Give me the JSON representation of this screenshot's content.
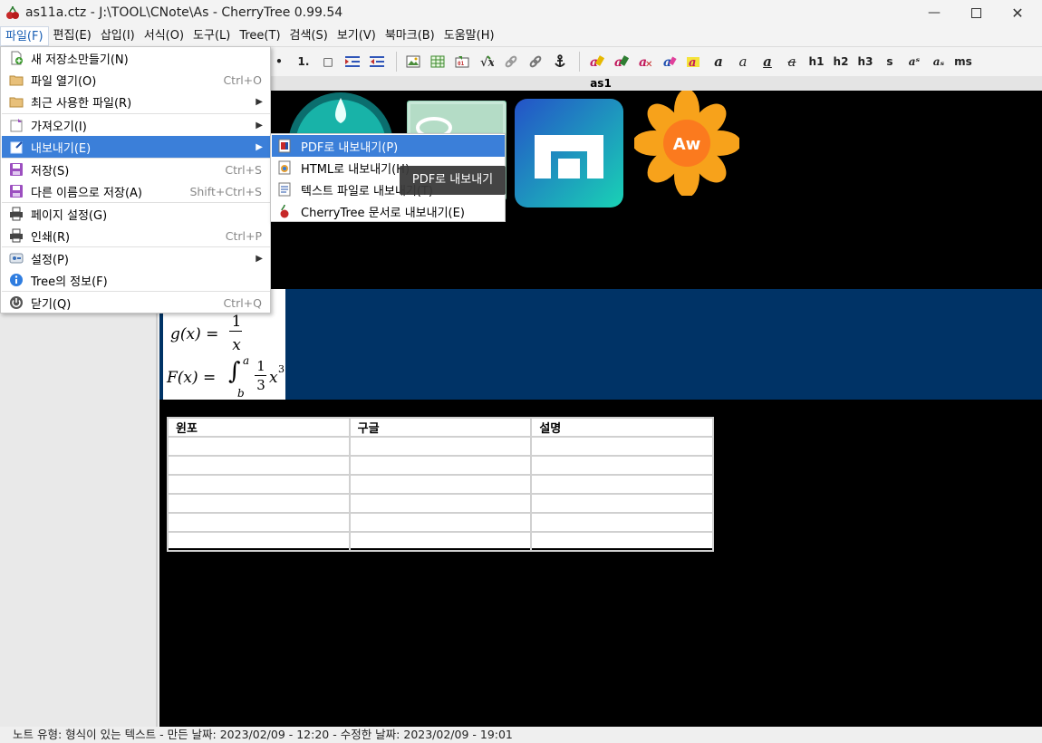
{
  "window": {
    "title": "as11a.ctz - J:\\TOOL\\CNote\\As - CherryTree 0.99.54",
    "minimize_icon": "minimize-icon",
    "maximize_icon": "maximize-icon",
    "close_icon": "close-icon"
  },
  "menubar": [
    {
      "label": "파일(F)",
      "active": true
    },
    {
      "label": "편집(E)"
    },
    {
      "label": "삽입(I)"
    },
    {
      "label": "서식(O)"
    },
    {
      "label": "도구(L)"
    },
    {
      "label": "Tree(T)"
    },
    {
      "label": "검색(S)"
    },
    {
      "label": "보기(V)"
    },
    {
      "label": "북마크(B)"
    },
    {
      "label": "도움말(H)"
    }
  ],
  "toolbar": {
    "list_items": [
      "•",
      "1.",
      "□"
    ],
    "format_items": [
      "h1",
      "h2",
      "h3",
      "s",
      "aˢ",
      "aₛ",
      "ms"
    ]
  },
  "node_title": "as1",
  "file_menu": {
    "items": [
      {
        "label": "새 저장소만들기(N)",
        "accel": "",
        "icon": "new-file-icon"
      },
      {
        "label": "파일 열기(O)",
        "accel": "Ctrl+O",
        "icon": "folder-open-icon"
      },
      {
        "label": "최근 사용한 파일(R)",
        "accel": "",
        "icon": "folder-recent-icon",
        "submenu": true
      },
      {
        "label": "가져오기(I)",
        "accel": "",
        "icon": "import-icon",
        "submenu": true
      },
      {
        "label": "내보내기(E)",
        "accel": "",
        "icon": "export-icon",
        "submenu": true,
        "selected": true
      },
      {
        "label": "저장(S)",
        "accel": "Ctrl+S",
        "icon": "save-icon"
      },
      {
        "label": "다른 이름으로 저장(A)",
        "accel": "Shift+Ctrl+S",
        "icon": "save-as-icon"
      },
      {
        "label": "페이지 설정(G)",
        "accel": "",
        "icon": "page-setup-icon"
      },
      {
        "label": "인쇄(R)",
        "accel": "Ctrl+P",
        "icon": "print-icon"
      },
      {
        "label": "설정(P)",
        "accel": "",
        "icon": "settings-icon",
        "submenu": true
      },
      {
        "label": "Tree의 정보(F)",
        "accel": "",
        "icon": "info-icon"
      },
      {
        "label": "닫기(Q)",
        "accel": "Ctrl+Q",
        "icon": "power-icon"
      }
    ]
  },
  "export_submenu": {
    "items": [
      {
        "label": "PDF로 내보내기(P)",
        "icon": "pdf-icon",
        "selected": true
      },
      {
        "label": "HTML로 내보내기(H)",
        "icon": "html-icon"
      },
      {
        "label": "텍스트 파일로 내보내기(T)",
        "icon": "text-file-icon"
      },
      {
        "label": "CherryTree 문서로 내보내기(E)",
        "icon": "cherry-icon"
      }
    ]
  },
  "tooltip": "PDF로 내보내기",
  "content": {
    "math_line1_lhs": "g(x) =",
    "math_line1_num": "1",
    "math_line1_den": "x",
    "math_line2_lhs": "F(x) =",
    "math_line2_sup": "a",
    "math_line2_sub": "b",
    "math_line2_num": "1",
    "math_line2_den": "3",
    "math_line2_tail": "x",
    "math_line2_exp": "3",
    "table_headers": [
      "윈포",
      "구글",
      "설명"
    ],
    "table_rows": 6,
    "logo_text": "Aw"
  },
  "statusbar": "노트 유형: 형식이 있는 텍스트  -  만든 날짜: 2023/02/09 - 12:20  -  수정한 날짜: 2023/02/09 - 19:01"
}
